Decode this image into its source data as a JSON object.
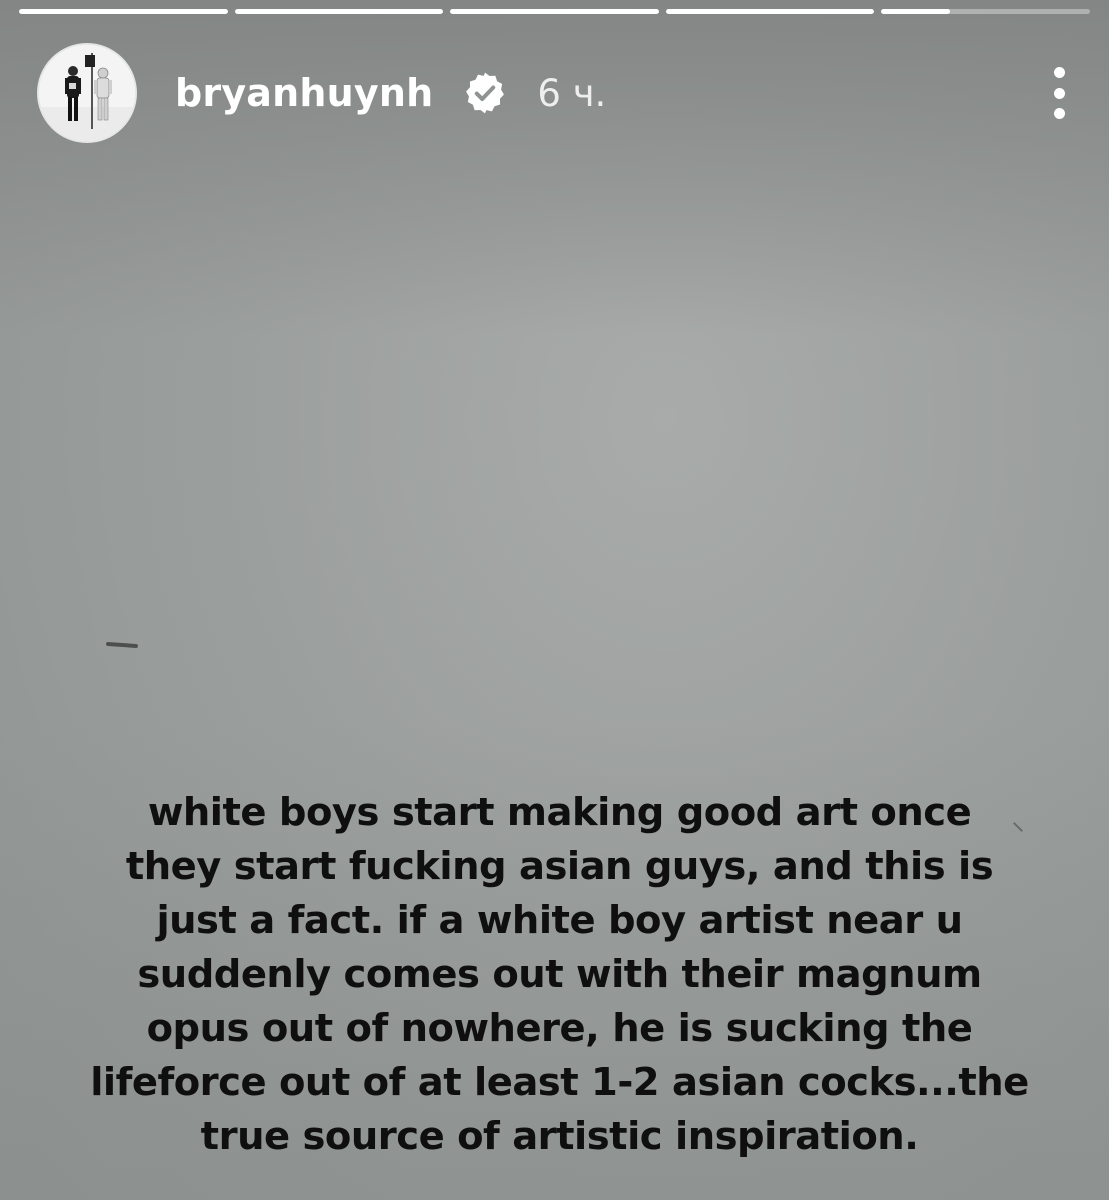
{
  "progress": {
    "segments": [
      1,
      1,
      1,
      1,
      0.33
    ]
  },
  "header": {
    "username": "bryanhuynh",
    "verified": true,
    "timestamp": "6 ч.",
    "avatar_icon": "profile-photo",
    "more_icon": "vertical-ellipsis-icon",
    "verified_icon": "verified-badge-icon"
  },
  "caption": {
    "lines": [
      "white boys start making good art once",
      "they start fucking asian guys, and this is",
      "just a fact. if a white boy artist near u",
      "suddenly comes out with their magnum",
      "opus out of nowhere, he is sucking the",
      "lifeforce out of at least 1-2 asian cocks...the",
      "true source of artistic inspiration."
    ]
  },
  "colors": {
    "background": "#9b9f9d",
    "caption_text": "#0f0f0f",
    "header_text": "#ffffff"
  }
}
